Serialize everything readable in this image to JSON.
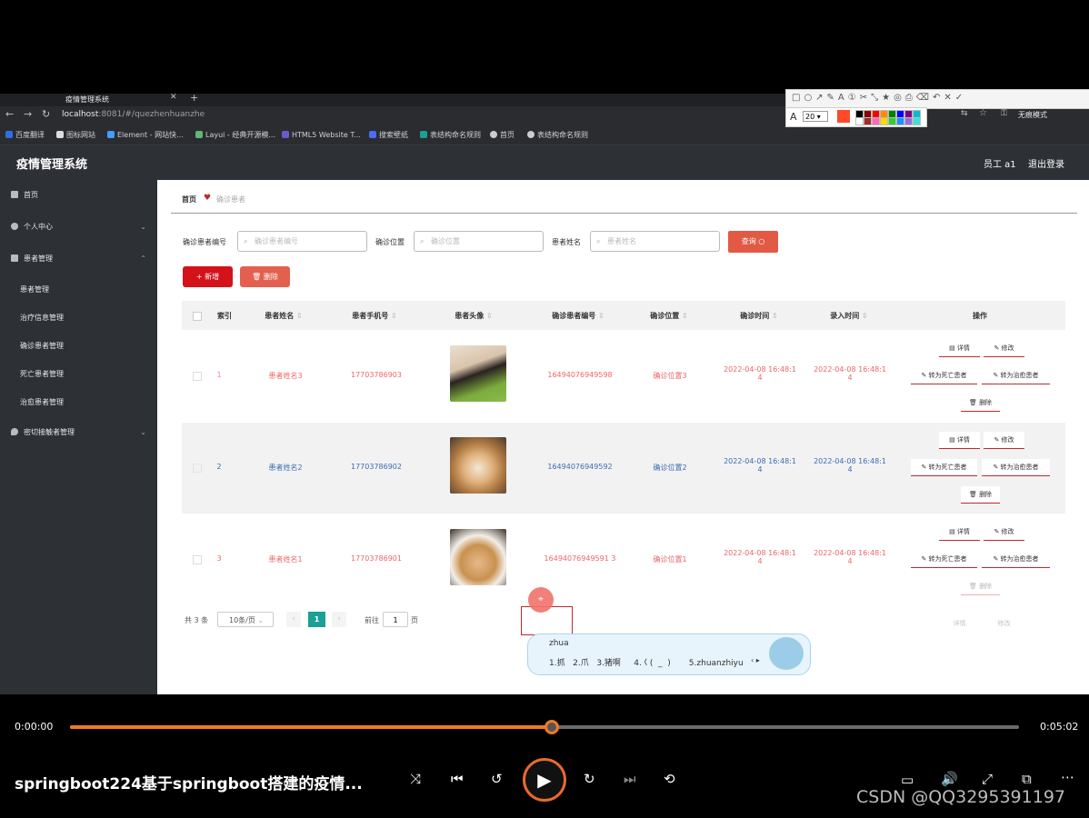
{
  "browser": {
    "tab_title": "疫情管理系统",
    "url_host": "localhost",
    "url_rest": ":8081/#/quezhenhuanzhe",
    "bookmarks": [
      "百度翻译",
      "图标网站",
      "Element - 网站快...",
      "Layui - 经典开源模...",
      "HTML5 Website T...",
      "搜索壁纸",
      "表结构命名规则",
      "首页",
      "表结构命名规则"
    ],
    "font_size": "20",
    "guest_mode": "无痕模式",
    "swatch_colors": [
      "#000000",
      "#8b0000",
      "#ff0000",
      "#ff8c00",
      "#008000",
      "#0000ff",
      "#800080",
      "#00bcd4",
      "#ffffff",
      "#a52a2a",
      "#ff69b4",
      "#ffd700",
      "#32cd32",
      "#1e90ff",
      "#9370db",
      "#40e0d0"
    ]
  },
  "app": {
    "system_name": "疫情管理系统",
    "user_label": "员工 a1",
    "logout_label": "退出登录"
  },
  "sidebar": {
    "home": "首页",
    "personal_center": "个人中心",
    "patient_management": "患者管理",
    "sub_items": [
      "患者管理",
      "治疗信息管理",
      "确诊患者管理",
      "死亡患者管理",
      "治愈患者管理"
    ],
    "close_contacts": "密切接触者管理"
  },
  "breadcrumb": {
    "home": "首页",
    "current": "确诊患者"
  },
  "search": {
    "label_number": "确诊患者编号",
    "placeholder_number": "确诊患者编号",
    "label_location": "确诊位置",
    "placeholder_location": "确诊位置",
    "label_name": "患者姓名",
    "placeholder_name": "患者姓名",
    "query_label": "查询"
  },
  "actions": {
    "add_label": "新增",
    "delete_label": "删除"
  },
  "table": {
    "headers": [
      "索引",
      "患者姓名",
      "患者手机号",
      "患者头像",
      "确诊患者编号",
      "确诊位置",
      "确诊时间",
      "录入时间",
      "操作"
    ],
    "rows": [
      {
        "index": "1",
        "name": "患者姓名3",
        "phone": "17703786903",
        "avatar": "girl-photo",
        "number": "16494076949598",
        "location": "确诊位置3",
        "confirm_time_1": "2022-04-08 16:48:1",
        "confirm_time_2": "4",
        "entry_time_1": "2022-04-08 16:48:1",
        "entry_time_2": "4"
      },
      {
        "index": "2",
        "name": "患者姓名2",
        "phone": "17703786902",
        "avatar": "shiba-dog-photo",
        "number": "16494076949592",
        "location": "确诊位置2",
        "confirm_time_1": "2022-04-08 16:48:1",
        "confirm_time_2": "4",
        "entry_time_1": "2022-04-08 16:48:1",
        "entry_time_2": "4"
      },
      {
        "index": "3",
        "name": "患者姓名1",
        "phone": "17703786901",
        "avatar": "cat-photo",
        "number": "16494076949591 3",
        "location": "确诊位置1",
        "confirm_time_1": "2022-04-08 16:48:1",
        "confirm_time_2": "4",
        "entry_time_1": "2022-04-08 16:48:1",
        "entry_time_2": "4"
      }
    ],
    "op_labels": {
      "detail": "详情",
      "edit": "修改",
      "to_dead": "转为死亡患者",
      "to_cured": "转为治愈患者",
      "delete": "删除"
    }
  },
  "pagination": {
    "total": "共 3 条",
    "page_size": "10条/页",
    "current_page": "1",
    "goto_label": "前往",
    "goto_value": "1",
    "page_suffix": "页"
  },
  "ime": {
    "input": "zhua",
    "candidates": "1.抓   2.爪   3.猪啊     4.𡿨(  _  )       5.zhuanzhiyu"
  },
  "player": {
    "time_current": "0:00:00",
    "time_total": "0:05:02",
    "progress_fraction": 0.508,
    "title": "springboot224基于springboot搭建的疫情...",
    "watermark": "CSDN @QQ3295391197"
  },
  "colors": {
    "accent_red": "#d4121a",
    "header_bg": "#2d3035",
    "page_active": "#1aa094",
    "progress": "#f07a22"
  }
}
